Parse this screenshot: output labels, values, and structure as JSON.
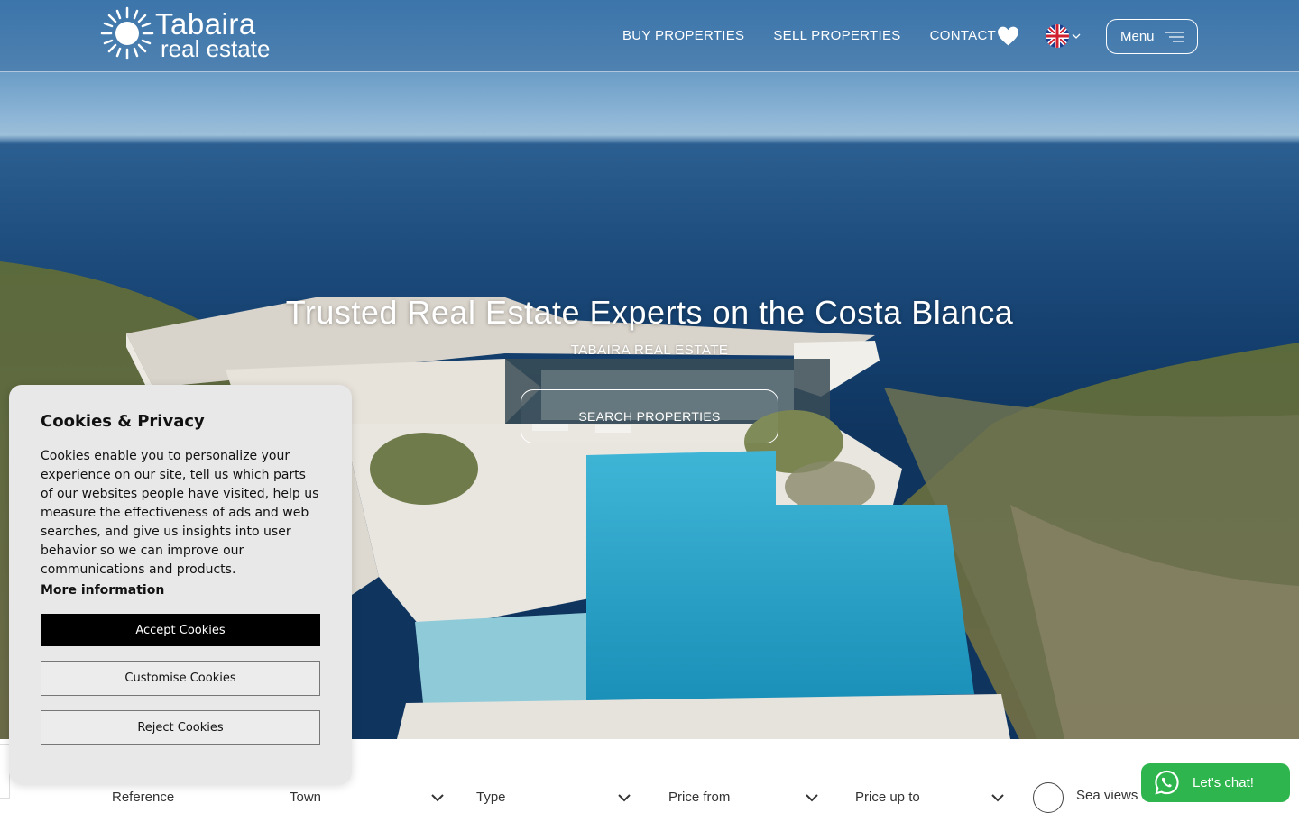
{
  "header": {
    "logo": {
      "line1": "Tabaira",
      "line2": "real estate"
    },
    "nav": [
      {
        "label": "BUY PROPERTIES"
      },
      {
        "label": "SELL PROPERTIES"
      },
      {
        "label": "CONTACT"
      }
    ],
    "favorites_icon": "heart-icon",
    "language_icon": "uk-flag-icon",
    "menu_label": "Menu"
  },
  "hero": {
    "title": "Trusted Real Estate Experts on the Costa Blanca",
    "subtitle": "TABAIRA REAL ESTATE",
    "cta_label": "SEARCH PROPERTIES"
  },
  "search_bar": {
    "reference": "Reference",
    "town": "Town",
    "type": "Type",
    "price_from": "Price from",
    "price_up_to": "Price up to",
    "sea_views": "Sea views"
  },
  "cookie_panel": {
    "title": "Cookies & Privacy",
    "body": "Cookies enable you to personalize your experience on our site, tell us which parts of our websites people have visited, help us measure the effectiveness of ads and web searches, and give us insights into user behavior so we can improve our communications and products.",
    "more_info": "More information",
    "accept": "Accept Cookies",
    "customise": "Customise Cookies",
    "reject": "Reject Cookies"
  },
  "chat": {
    "label": "Let's chat!",
    "icon": "whatsapp-icon"
  },
  "colors": {
    "chat_green": "#2fb54e",
    "header_overlay": "#3a6ea0",
    "cookie_bg": "#e8e8e8",
    "accept_bg": "#000000"
  }
}
